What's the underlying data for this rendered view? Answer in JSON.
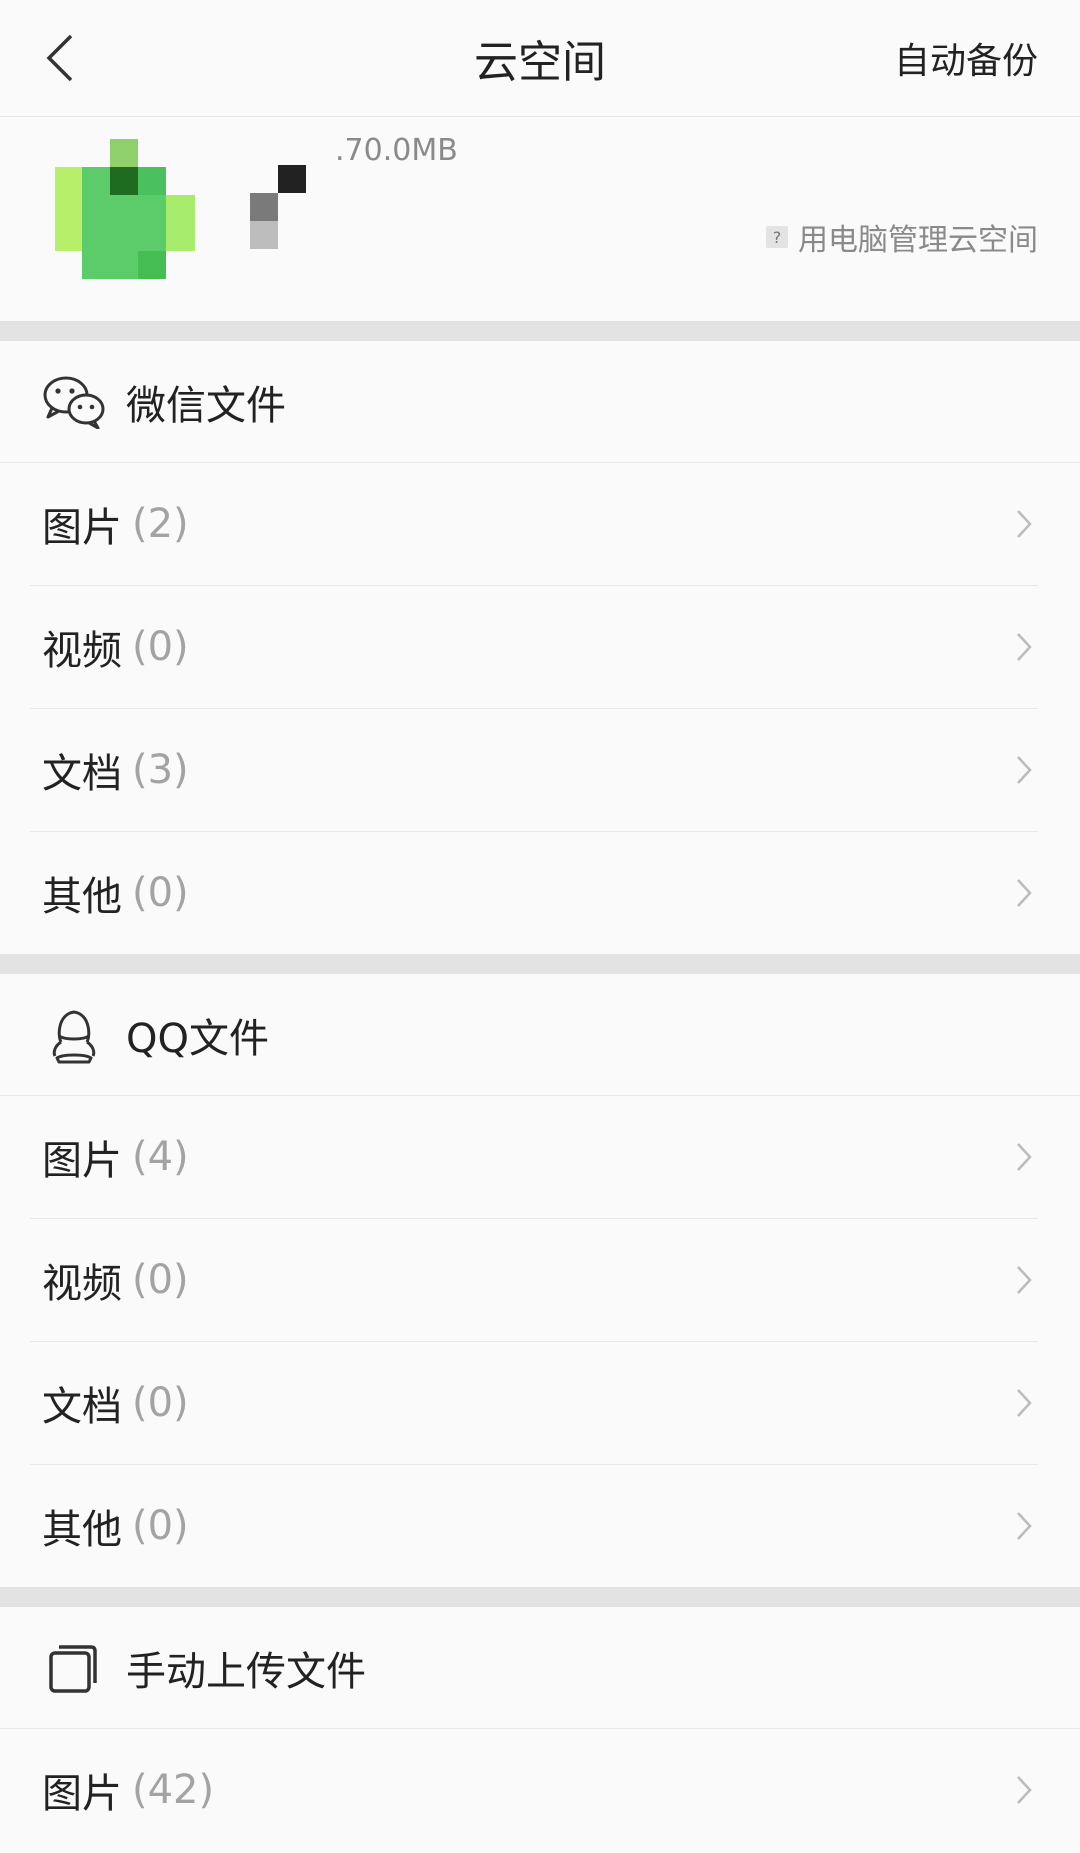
{
  "header": {
    "title": "云空间",
    "auto_backup": "自动备份"
  },
  "user": {
    "storage_used": ".70.0MB",
    "manage_label": "用电脑管理云空间",
    "help_badge": "?"
  },
  "sections": [
    {
      "title": "微信文件",
      "icon": "wechat-icon",
      "rows": [
        {
          "label": "图片",
          "count": "(2)"
        },
        {
          "label": "视频",
          "count": "(0)"
        },
        {
          "label": "文档",
          "count": "(3)"
        },
        {
          "label": "其他",
          "count": "(0)"
        }
      ]
    },
    {
      "title": "QQ文件",
      "icon": "qq-icon",
      "rows": [
        {
          "label": "图片",
          "count": "(4)"
        },
        {
          "label": "视频",
          "count": "(0)"
        },
        {
          "label": "文档",
          "count": "(0)"
        },
        {
          "label": "其他",
          "count": "(0)"
        }
      ]
    },
    {
      "title": "手动上传文件",
      "icon": "upload-files-icon",
      "rows": [
        {
          "label": "图片",
          "count": "(42)"
        }
      ]
    }
  ],
  "colors": {
    "background": "#fafafa",
    "divider": "#e3e3e3",
    "muted_text": "#a3a3a3",
    "avatar_green": "#5ccc6a"
  }
}
